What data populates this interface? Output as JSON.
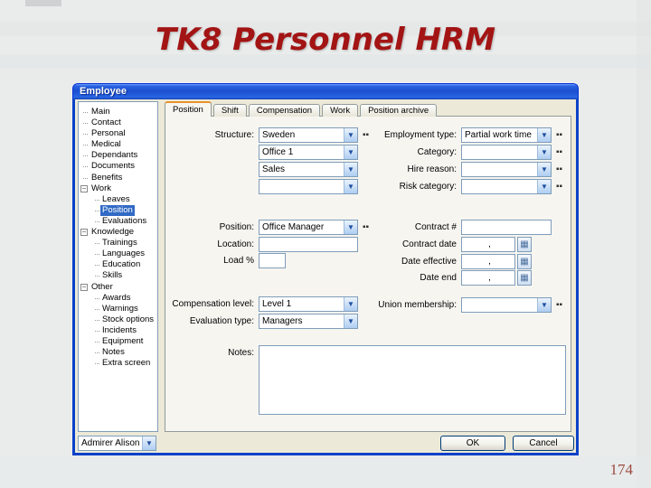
{
  "slide": {
    "title": "TK8 Personnel HRM",
    "page_number": "174"
  },
  "colors": {
    "title_text": "#a31414",
    "titlebar_blue": "#1b4fd0",
    "dialog_border": "#0b41c9",
    "dialog_bg": "#ece9d8",
    "tree_selection": "#316ac5",
    "active_tab_accent": "#e5932c",
    "page_number": "#9c4a42"
  },
  "icons": {
    "chevron_down": "▼",
    "calendar": "▦",
    "edit_list": "▪▪",
    "tree_collapse": "−"
  },
  "dialog": {
    "title": "Employee",
    "tree": {
      "items": [
        {
          "label": "Main",
          "level": 0
        },
        {
          "label": "Contact",
          "level": 0
        },
        {
          "label": "Personal",
          "level": 0
        },
        {
          "label": "Medical",
          "level": 0
        },
        {
          "label": "Dependants",
          "level": 0
        },
        {
          "label": "Documents",
          "level": 0
        },
        {
          "label": "Benefits",
          "level": 0
        },
        {
          "label": "Work",
          "level": 0,
          "expander": true
        },
        {
          "label": "Leaves",
          "level": 1
        },
        {
          "label": "Position",
          "level": 1,
          "selected": true
        },
        {
          "label": "Evaluations",
          "level": 1
        },
        {
          "label": "Knowledge",
          "level": 0,
          "expander": true
        },
        {
          "label": "Trainings",
          "level": 1
        },
        {
          "label": "Languages",
          "level": 1
        },
        {
          "label": "Education",
          "level": 1
        },
        {
          "label": "Skills",
          "level": 1
        },
        {
          "label": "Other",
          "level": 0,
          "expander": true
        },
        {
          "label": "Awards",
          "level": 1
        },
        {
          "label": "Warnings",
          "level": 1
        },
        {
          "label": "Stock options",
          "level": 1
        },
        {
          "label": "Incidents",
          "level": 1
        },
        {
          "label": "Equipment",
          "level": 1
        },
        {
          "label": "Notes",
          "level": 1
        },
        {
          "label": "Extra screen",
          "level": 1
        }
      ]
    },
    "tabs": [
      "Position",
      "Shift",
      "Compensation",
      "Work",
      "Position archive"
    ],
    "active_tab": "Position",
    "form": {
      "structure": {
        "label": "Structure:",
        "values": [
          "Sweden",
          "Office 1",
          "Sales",
          ""
        ]
      },
      "employment_type": {
        "label": "Employment type:",
        "value": "Partial work time"
      },
      "category": {
        "label": "Category:",
        "value": ""
      },
      "hire_reason": {
        "label": "Hire reason:",
        "value": ""
      },
      "risk_category": {
        "label": "Risk category:",
        "value": ""
      },
      "position": {
        "label": "Position:",
        "value": "Office Manager"
      },
      "location": {
        "label": "Location:",
        "value": ""
      },
      "load": {
        "label": "Load %",
        "value": ""
      },
      "contract_no": {
        "label": "Contract #",
        "value": ""
      },
      "contract_date": {
        "label": "Contract date",
        "value": ","
      },
      "date_effective": {
        "label": "Date effective",
        "value": ","
      },
      "date_end": {
        "label": "Date end",
        "value": ","
      },
      "compensation_level": {
        "label": "Compensation level:",
        "value": "Level 1"
      },
      "evaluation_type": {
        "label": "Evaluation type:",
        "value": "Managers"
      },
      "union_membership": {
        "label": "Union membership:",
        "value": ""
      },
      "notes": {
        "label": "Notes:",
        "value": ""
      }
    },
    "footer": {
      "employee_selector": "Admirer Alison",
      "ok_label": "OK",
      "cancel_label": "Cancel"
    }
  }
}
